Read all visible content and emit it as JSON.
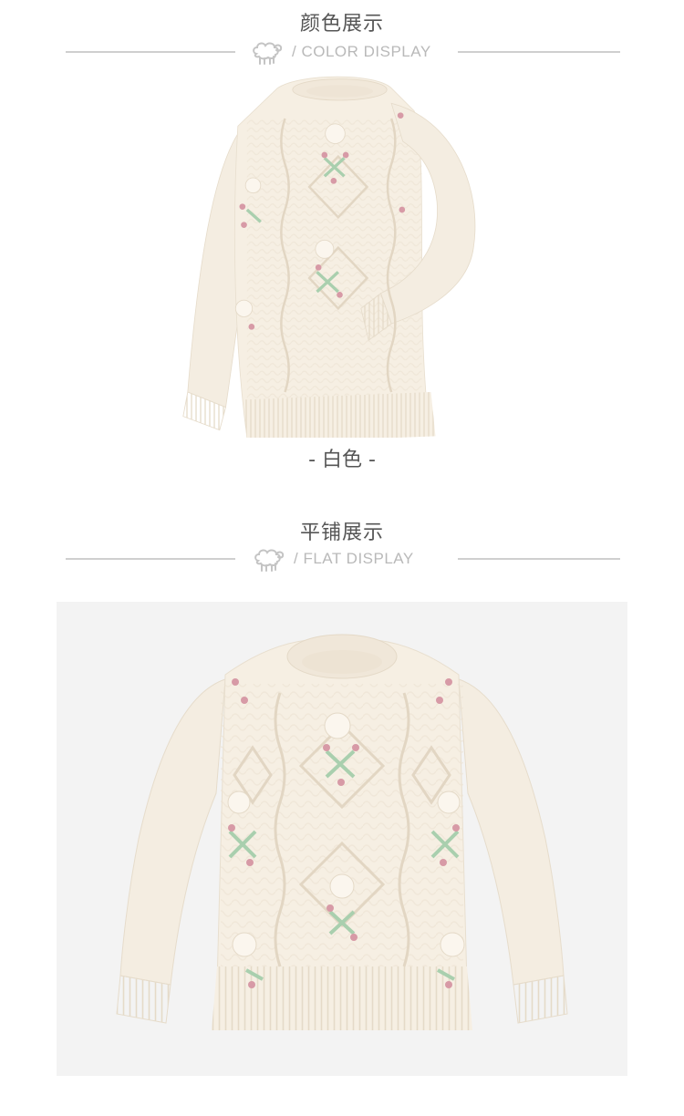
{
  "color_section": {
    "title_cn": "颜色展示",
    "subtitle_en": "/ COLOR DISPLAY",
    "icon": "sheep-icon",
    "variant_caption": "- 白色 -"
  },
  "flat_section": {
    "title_cn": "平铺展示",
    "subtitle_en": "/  FLAT DISPLAY",
    "icon": "sheep-icon"
  },
  "colors": {
    "sweater": "#f6efe3",
    "rose": "#d79aa6",
    "leaf": "#a9cfae",
    "rule": "#cfcfcf"
  }
}
